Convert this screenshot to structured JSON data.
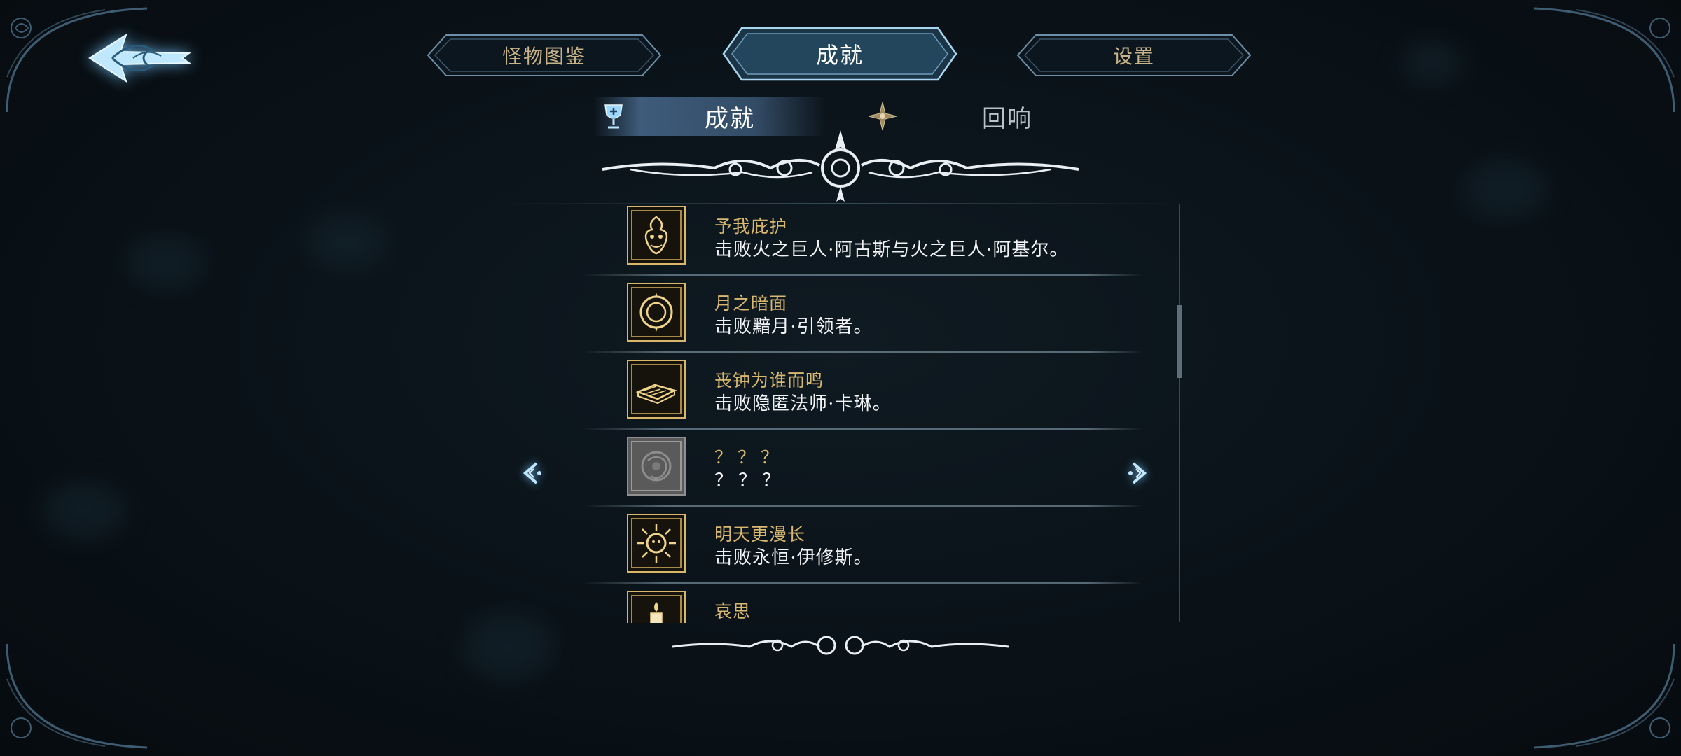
{
  "header": {
    "back_icon": "back-arrow-icon",
    "tabs": [
      {
        "label": "怪物图鉴"
      },
      {
        "label": "成就",
        "active": true
      },
      {
        "label": "设置"
      }
    ]
  },
  "subtabs": [
    {
      "label": "成就",
      "icon": "trophy-icon",
      "active": true
    },
    {
      "label": "回响",
      "icon": "compass-star-icon",
      "active": false
    }
  ],
  "achievements": [
    {
      "title": "予我庇护",
      "description": "击败火之巨人·阿古斯与火之巨人·阿基尔。",
      "icon": "fire-giant-icon",
      "locked": false
    },
    {
      "title": "月之暗面",
      "description": "击败黯月·引领者。",
      "icon": "moon-ring-icon",
      "locked": false
    },
    {
      "title": "丧钟为谁而鸣",
      "description": "击败隐匿法师·卡琳。",
      "icon": "open-book-icon",
      "locked": false
    },
    {
      "title": "？？？",
      "description": "？？？",
      "icon": "locked-sigil-icon",
      "locked": true
    },
    {
      "title": "明天更漫长",
      "description": "击败永恒·伊修斯。",
      "icon": "radiant-sun-icon",
      "locked": false
    },
    {
      "title": "哀思",
      "description": "",
      "icon": "candle-icon",
      "locked": false
    }
  ],
  "colors": {
    "gold_text": "#d9b870",
    "glow_blue": "#8fd4ff",
    "frame_gold": "#d8b66a"
  }
}
